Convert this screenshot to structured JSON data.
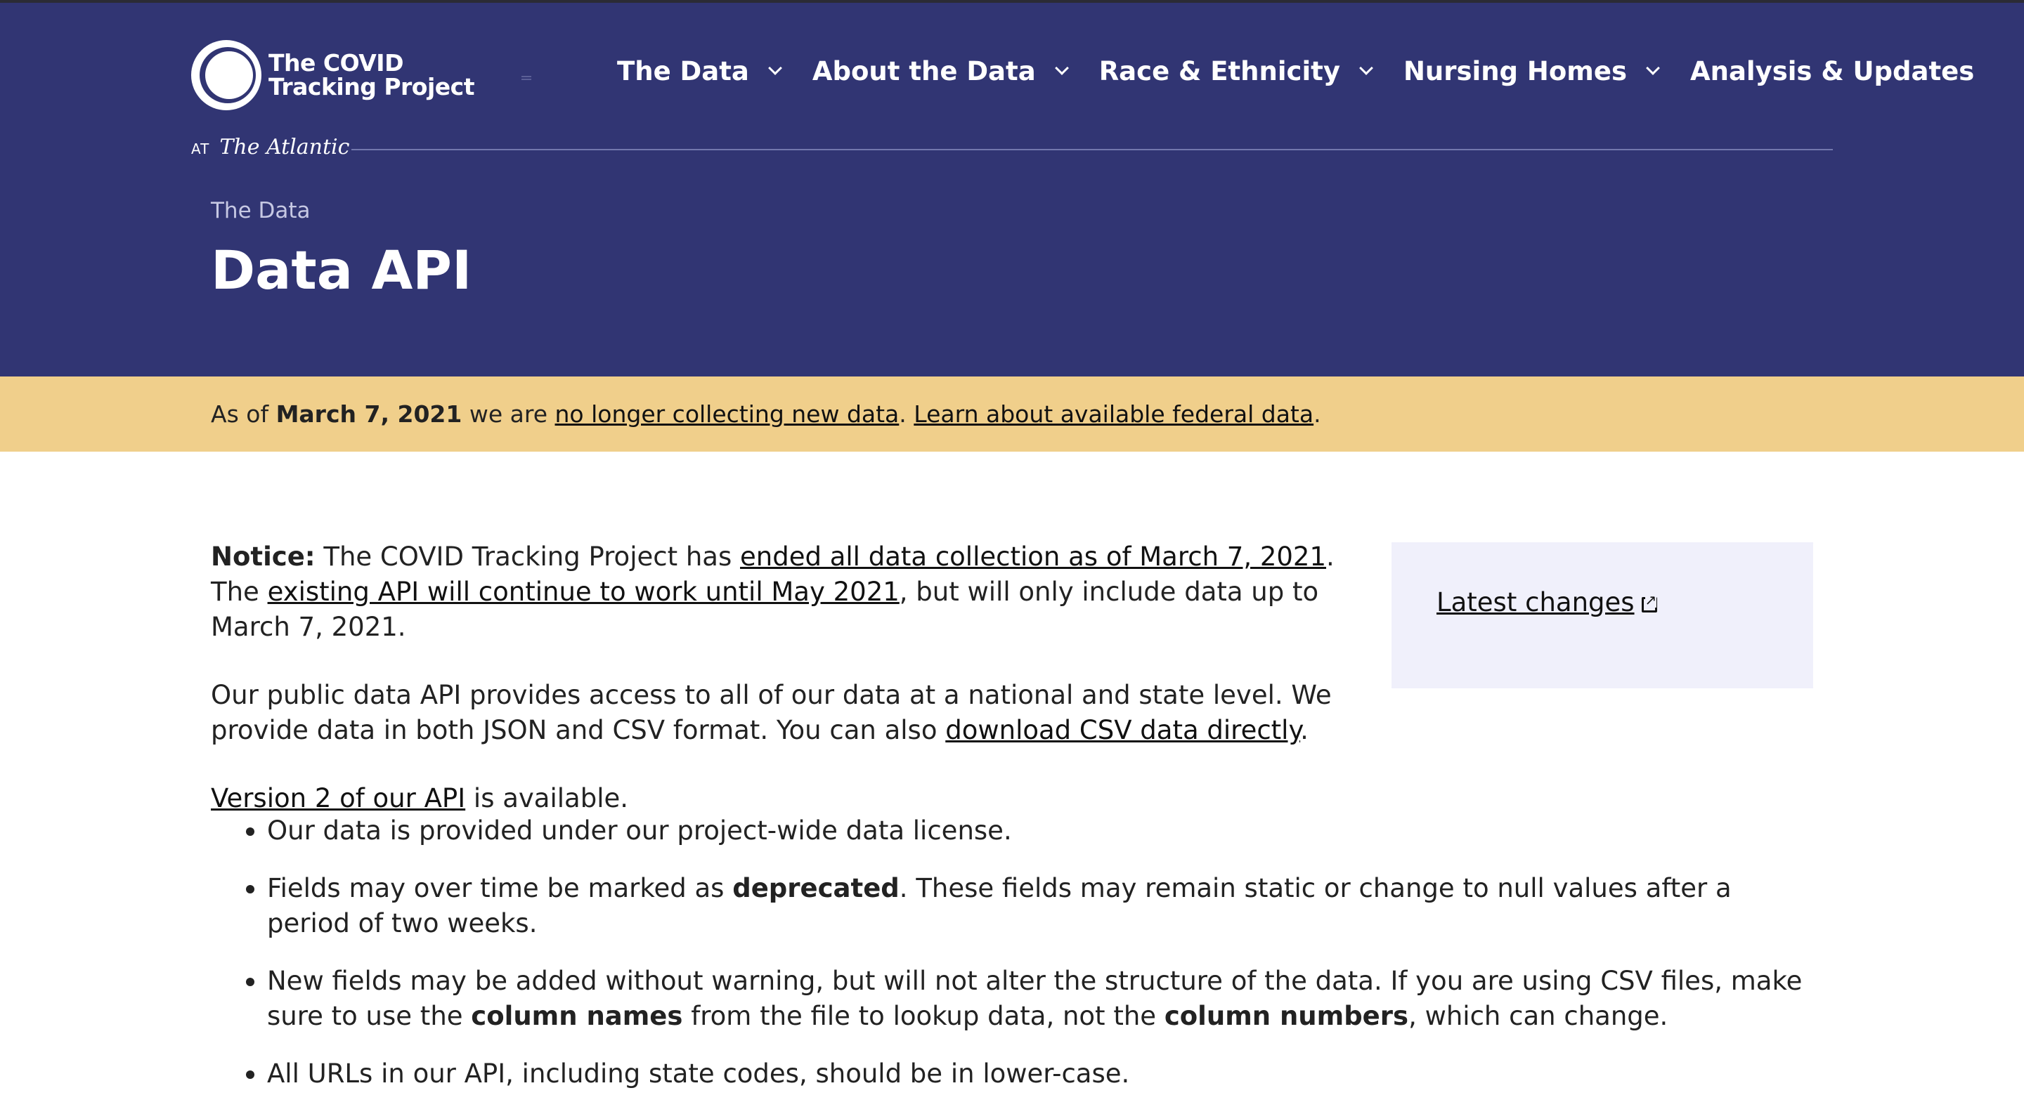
{
  "logo": {
    "line1": "The COVID",
    "line2": "Tracking Project",
    "at": "AT",
    "publisher": "The Atlantic"
  },
  "nav": {
    "items": [
      {
        "label": "The Data",
        "dropdown": true
      },
      {
        "label": "About the Data",
        "dropdown": true
      },
      {
        "label": "Race & Ethnicity",
        "dropdown": true
      },
      {
        "label": "Nursing Homes",
        "dropdown": true
      },
      {
        "label": "Analysis & Updates",
        "dropdown": false
      }
    ]
  },
  "breadcrumb": "The Data",
  "page_title": "Data API",
  "banner": {
    "prefix": "As of ",
    "date": "March 7, 2021",
    "middle": " we are ",
    "link1": "no longer collecting new data",
    "sep": ". ",
    "link2": "Learn about available federal data",
    "end": "."
  },
  "notice": {
    "label": "Notice:",
    "text1": " The COVID Tracking Project has ",
    "link1": "ended all data collection as of March 7, 2021",
    "text2": ". The ",
    "link2": "existing API will continue to work until May 2021",
    "text3": ", but will only include data up to March 7, 2021."
  },
  "intro": {
    "text1": "Our public data API provides access to all of our data at a national and state level. We provide data in both JSON and CSV format. You can also ",
    "link": "download CSV data directly",
    "text2": "."
  },
  "version": {
    "link": "Version 2 of our API",
    "text": " is available."
  },
  "bullets": {
    "b1_text": "Our data is provided under our ",
    "b1_link": "project-wide data license",
    "b1_end": ".",
    "b2_text1": "Fields may over time be marked as ",
    "b2_bold": "deprecated",
    "b2_text2": ". These fields may remain static or change to null values after a period of two weeks.",
    "b3_text1": "New fields may be added without warning, but will not alter the structure of the data. If you are using CSV files, make sure to use the ",
    "b3_bold1": "column names",
    "b3_text2": " from the file to lookup data, not the ",
    "b3_bold2": "column numbers",
    "b3_text3": ", which can change.",
    "b4_text": "All URLs in our API, including state codes, should be in lower-case."
  },
  "sidebar": {
    "link": "Latest changes",
    "icon": "external-link-icon"
  },
  "colors": {
    "header_bg": "#313573",
    "banner_bg": "#f0cf8b",
    "sidebar_bg": "#f0f0fb"
  }
}
